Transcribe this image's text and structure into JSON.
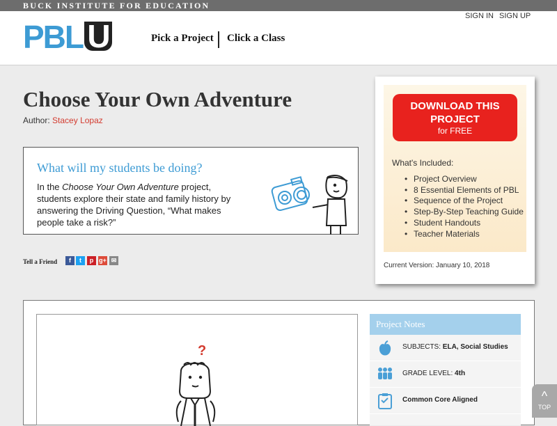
{
  "topbar": {
    "org": "BUCK INSTITUTE FOR EDUCATION"
  },
  "header": {
    "logo_pbl": "PBL",
    "logo_u": "U",
    "nav": [
      "Pick a Project",
      "Click a Class"
    ],
    "sign_in": "SIGN IN",
    "sign_up": "SIGN UP"
  },
  "page": {
    "title": "Choose Your Own Adventure",
    "author_label": "Author:",
    "author_name": "Stacey Lopaz"
  },
  "intro": {
    "heading": "What will my students be doing?",
    "text_prefix": "In the ",
    "text_italic": "Choose Your Own Adventure",
    "text_suffix": " project, students explore their state and family history by answering the Driving Question, “What makes people take a risk?”"
  },
  "share": {
    "label": "Tell a Friend",
    "icons": [
      "facebook-icon",
      "twitter-icon",
      "pinterest-icon",
      "google-plus-icon",
      "email-icon"
    ],
    "glyphs": [
      "f",
      "t",
      "p",
      "g+",
      "✉"
    ],
    "colors": [
      "#3b5998",
      "#1da1f2",
      "#cb2027",
      "#dd4b39",
      "#888888"
    ]
  },
  "download": {
    "line1": "DOWNLOAD THIS",
    "line2": "PROJECT",
    "line3": "for FREE",
    "included_label": "What's Included:",
    "items": [
      "Project Overview",
      "8 Essential Elements of PBL",
      "Sequence of the Project",
      "Step-By-Step Teaching Guide",
      "Student Handouts",
      "Teacher Materials"
    ],
    "version": "Current Version: January 10, 2018"
  },
  "notes": {
    "header": "Project Notes",
    "subjects_label": "SUBJECTS:",
    "subjects_value": "ELA, Social Studies",
    "grade_label": "GRADE LEVEL:",
    "grade_value": "4th",
    "common_core": "Common Core Aligned"
  },
  "totop": {
    "caret": "^",
    "label": "TOP"
  },
  "colors": {
    "accent_blue": "#3d9bd4",
    "download_red": "#e8221e",
    "notes_blue": "#a4d0ec"
  }
}
